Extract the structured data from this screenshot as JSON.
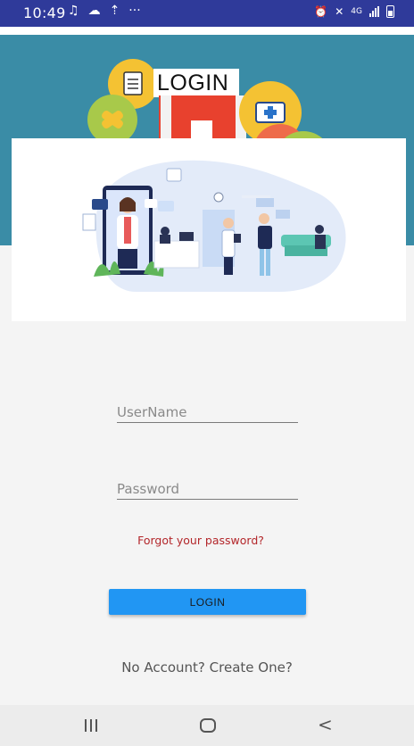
{
  "status_bar": {
    "time": "10:49",
    "left_icons": [
      "music-note-icon",
      "cloud-icon",
      "upload-icon",
      "more-dots-icon"
    ],
    "right_icons": [
      "alarm-icon",
      "mute-icon",
      "network-4g-icon",
      "signal-icon",
      "battery-icon"
    ],
    "network_label": "4G"
  },
  "header": {
    "title": "LOGIN",
    "background_color": "#3a8ca6"
  },
  "form": {
    "username_placeholder": "UserName",
    "password_placeholder": "Password",
    "forgot_password": "Forgot  your password?",
    "login_button": "LOGIN",
    "create_account": "No Account? Create One?"
  },
  "colors": {
    "status_bar": "#2f3a9a",
    "button": "#2196f3",
    "forgot_link": "#b3262a"
  },
  "nav_bar": {
    "icons": [
      "recents-icon",
      "home-icon",
      "back-icon"
    ]
  }
}
